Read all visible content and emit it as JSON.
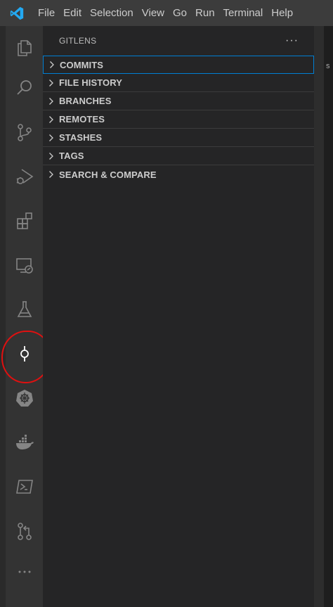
{
  "menubar": {
    "items": [
      "File",
      "Edit",
      "Selection",
      "View",
      "Go",
      "Run",
      "Terminal",
      "Help"
    ]
  },
  "activity_bar": {
    "items": [
      {
        "name": "explorer-icon"
      },
      {
        "name": "search-icon"
      },
      {
        "name": "source-control-icon"
      },
      {
        "name": "run-debug-icon"
      },
      {
        "name": "extensions-icon"
      },
      {
        "name": "remote-explorer-icon"
      },
      {
        "name": "testing-icon"
      },
      {
        "name": "gitlens-commit-icon",
        "active": true
      },
      {
        "name": "kubernetes-icon"
      },
      {
        "name": "docker-icon"
      },
      {
        "name": "powershell-icon"
      },
      {
        "name": "pull-requests-icon"
      },
      {
        "name": "more-icon"
      }
    ]
  },
  "sidebar": {
    "title": "GITLENS",
    "more": "···",
    "sections": [
      {
        "label": "COMMITS"
      },
      {
        "label": "FILE HISTORY"
      },
      {
        "label": "BRANCHES"
      },
      {
        "label": "REMOTES"
      },
      {
        "label": "STASHES"
      },
      {
        "label": "TAGS"
      },
      {
        "label": "SEARCH & COMPARE"
      }
    ]
  },
  "editor": {
    "peek_text": "s"
  },
  "colors": {
    "accent": "#007fd4",
    "annotation": "#e01010",
    "logo": "#23a9f2"
  }
}
